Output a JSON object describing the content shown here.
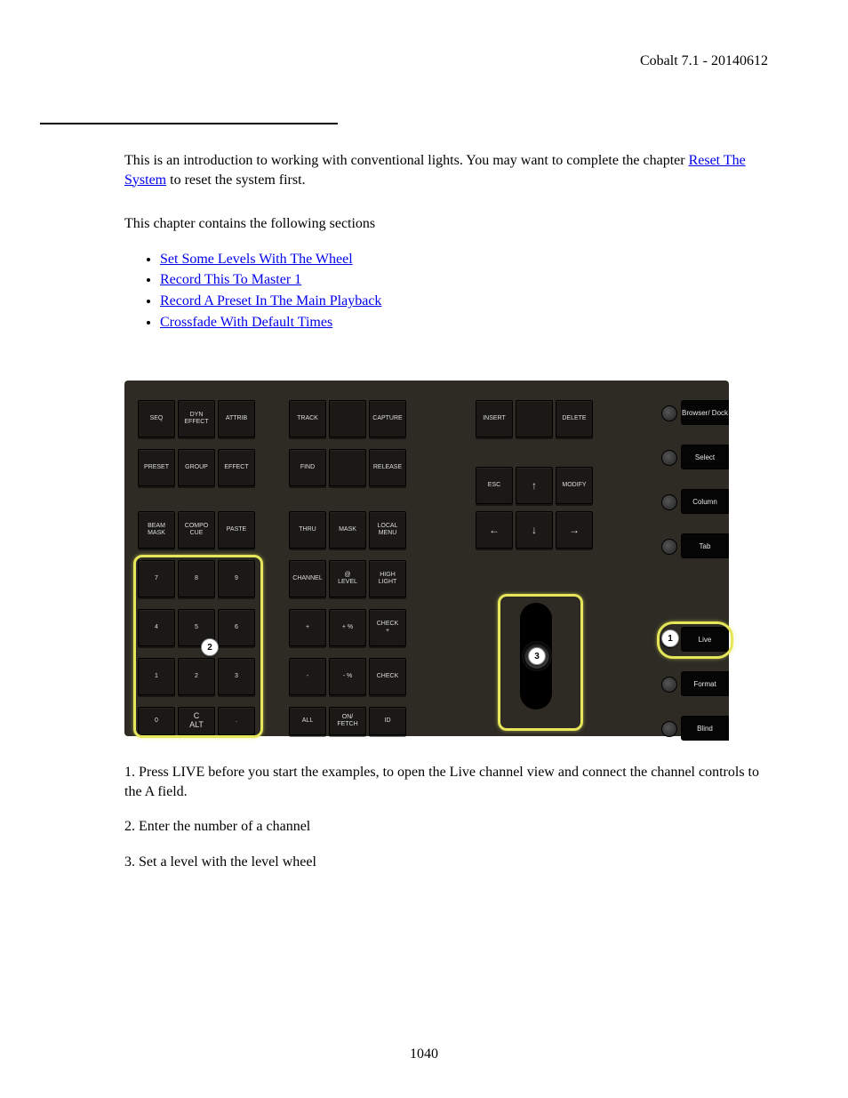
{
  "header": {
    "doc_title": "Cobalt 7.1 - 20140612"
  },
  "intro": {
    "p1a": "This is an introduction to working with conventional lights. You may want to complete the chapter ",
    "link1": "Reset The System",
    "p1b": " to reset the system first.",
    "p2": "This chapter contains the following sections"
  },
  "toc": {
    "i1": "Set Some Levels With The Wheel",
    "i2": "Record This To Master 1",
    "i3": "Record A Preset In The Main Playback",
    "i4": "Crossfade With Default Times "
  },
  "keys": {
    "seq": "SEQ",
    "dynEffect": "DYN\nEFFECT",
    "attrib": "ATTRIB",
    "track": "TRACK",
    "capture": "CAPTURE",
    "preset": "PRESET",
    "group": "GROUP",
    "effect": "EFFECT",
    "find": "FIND",
    "release": "RELEASE",
    "insert": "INSERT",
    "delete": "DELETE",
    "esc": "ESC",
    "modify": "MODIFY",
    "beamMask": "BEAM\nMASK",
    "compCue": "COMPO\nCUE",
    "paste": "PASTE",
    "thru": "THRU",
    "mask": "MASK",
    "localMenu": "LOCAL\nMENU",
    "k7": "7",
    "k8": "8",
    "k9": "9",
    "channel": "CHANNEL",
    "atLevel": "@\nLEVEL",
    "highlight": "HIGH\nLIGHT",
    "k4": "4",
    "k5": "5",
    "k6": "6",
    "plus": "+",
    "plusPct": "+ %",
    "checkPlus": "CHECK\n+",
    "k1": "1",
    "k2": "2",
    "k3": "3",
    "minus": "-",
    "minusPct": "- %",
    "check": "CHECK",
    "k0": "0",
    "cAlt": "C\nALT",
    "dot": ".",
    "all": "ALL",
    "onFetch": "ON/\nFETCH",
    "id": "ID"
  },
  "arrows": {
    "up": "↑",
    "down": "↓",
    "left": "←",
    "right": "→"
  },
  "side": {
    "browser": "Browser/\nDock",
    "select": "Select",
    "column": "Column",
    "tab": "Tab",
    "live": "Live",
    "format": "Format",
    "blind": "Blind"
  },
  "markers": {
    "m1": "1",
    "m2": "2",
    "m3": "3"
  },
  "steps": {
    "s1": "1. Press LIVE before you start the examples, to open the Live channel view and connect the channel controls to the A field.",
    "s2": "2. Enter the number of a channel",
    "s3": "3. Set a level with the level wheel"
  },
  "page_number": "1040"
}
